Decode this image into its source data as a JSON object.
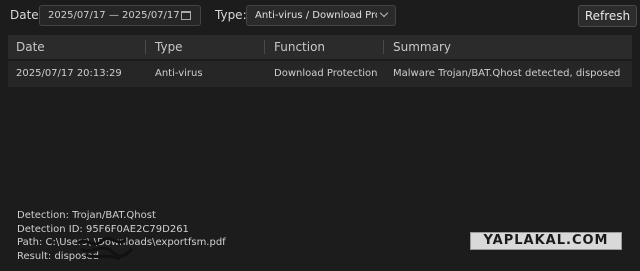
{
  "filter": {
    "date_label": "Date:",
    "date_from": "2025/07/17",
    "date_separator": "—",
    "date_to": "2025/07/17",
    "type_label": "Type:",
    "type_value": "Anti-virus / Download Protection",
    "refresh_label": "Refresh"
  },
  "table": {
    "columns": [
      "Date",
      "Type",
      "Function",
      "Summary"
    ],
    "rows": [
      {
        "date": "2025/07/17 20:13:29",
        "type": "Anti-virus",
        "function": "Download Protection",
        "summary": "Malware Trojan/BAT.Qhost detected, disposed"
      }
    ]
  },
  "details": {
    "detection": "Detection: Trojan/BAT.Qhost",
    "detection_id": "Detection ID: 95F6F0AE2C79D261",
    "path": "Path: C:\\Users\\        \\Downloads\\exportfsm.pdf",
    "result": "Result: disposed"
  },
  "watermark": "YAPLAKAL.COM",
  "colors": {
    "background": "#1c1c1c",
    "header": "#2b2b2b",
    "row": "#262626"
  }
}
